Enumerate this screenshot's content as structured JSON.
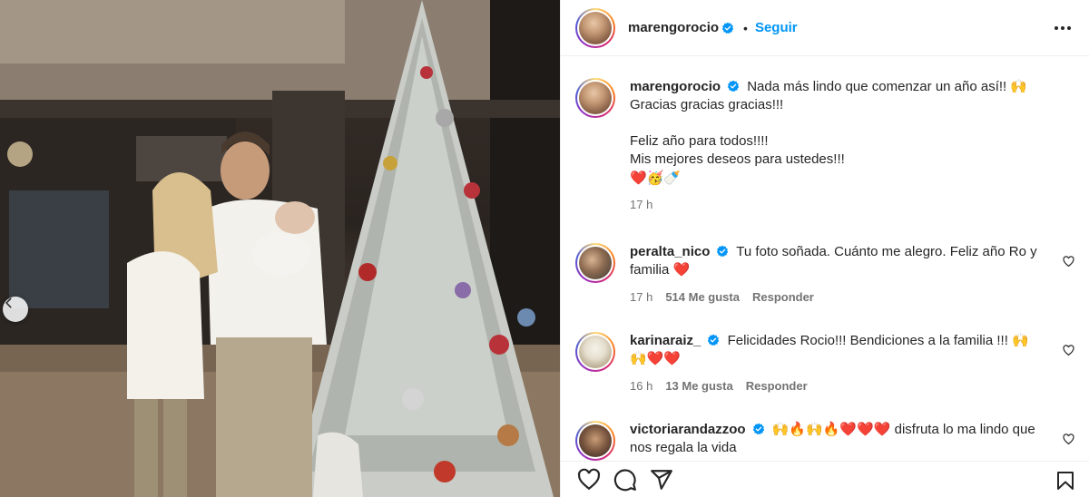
{
  "post": {
    "author": "marengorocio",
    "follow_label": "Seguir",
    "separator": "•",
    "caption_lines": [
      "Nada más lindo que comenzar un año así!! 🙌",
      "Gracias gracias gracias!!!",
      "",
      "Feliz año para todos!!!!",
      "Mis mejores deseos para ustedes!!!",
      "❤️🥳🍼"
    ],
    "caption_time": "17 h"
  },
  "comments": [
    {
      "author": "peralta_nico",
      "text": "Tu foto soñada. Cuánto me alegro. Feliz año Ro y familia ❤️",
      "time": "17 h",
      "likes": "514 Me gusta",
      "reply": "Responder"
    },
    {
      "author": "karinaraiz_",
      "text": "Felicidades Rocio!!! Bendiciones a la familia !!! 🙌🙌❤️❤️",
      "time": "16 h",
      "likes": "13 Me gusta",
      "reply": "Responder"
    },
    {
      "author": "victoriarandazzoo",
      "text": "🙌🔥🙌🔥❤️❤️❤️ disfruta lo ma lindo que nos regala la vida",
      "time": "",
      "likes": "",
      "reply": ""
    }
  ],
  "icons": {
    "verified": "verified-badge-icon",
    "more": "more-options-icon",
    "like": "heart-icon",
    "comment": "comment-icon",
    "share": "share-icon",
    "save": "bookmark-icon",
    "prev": "chevron-left-icon"
  },
  "colors": {
    "accent": "#0095f6",
    "verified": "#0095f6",
    "text": "#262626",
    "muted": "#737373"
  }
}
